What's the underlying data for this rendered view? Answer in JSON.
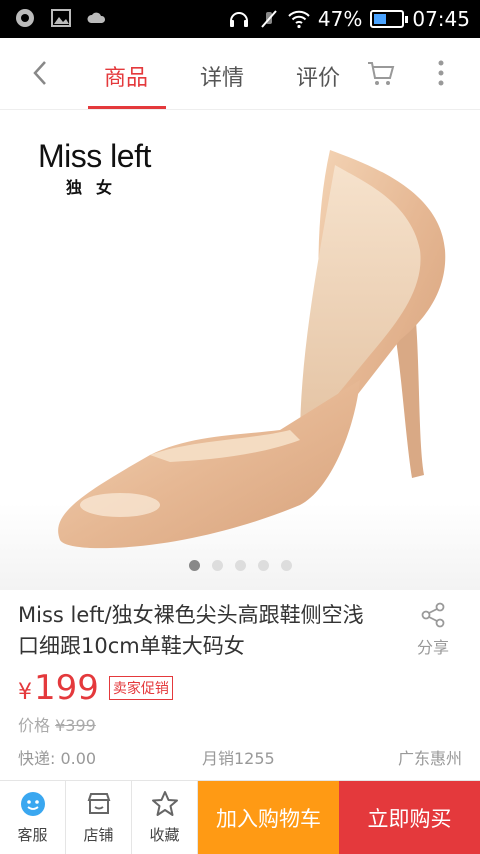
{
  "status_bar": {
    "battery": "47%",
    "battery_level": 0.47,
    "time": "07:45",
    "icons": [
      "app-icon",
      "image-icon",
      "cloud-icon",
      "headset-icon",
      "mute-icon",
      "wifi-icon",
      "battery-icon"
    ]
  },
  "header": {
    "tabs": [
      {
        "label": "商品",
        "active": true
      },
      {
        "label": "详情",
        "active": false
      },
      {
        "label": "评价",
        "active": false
      }
    ],
    "accent": "#e4393c"
  },
  "hero": {
    "brand": "Miss left",
    "brand_sub": "独女",
    "page_count": 5,
    "current_page": 1
  },
  "product": {
    "title": "Miss left/独女裸色尖头高跟鞋侧空浅口细跟10cm单鞋大码女",
    "share_label": "分享",
    "currency": "¥",
    "price": "199",
    "promo_tag": "卖家促销",
    "orig_label": "价格 ",
    "orig_price": "¥399",
    "shipping": "快递: 0.00",
    "monthly_sales": "月销1255",
    "location": "广东惠州"
  },
  "bottom_bar": {
    "service": "客服",
    "shop": "店铺",
    "favorite": "收藏",
    "add_cart": "加入购物车",
    "buy_now": "立即购买",
    "cart_color": "#ff9a14",
    "buy_color": "#e4393c"
  }
}
